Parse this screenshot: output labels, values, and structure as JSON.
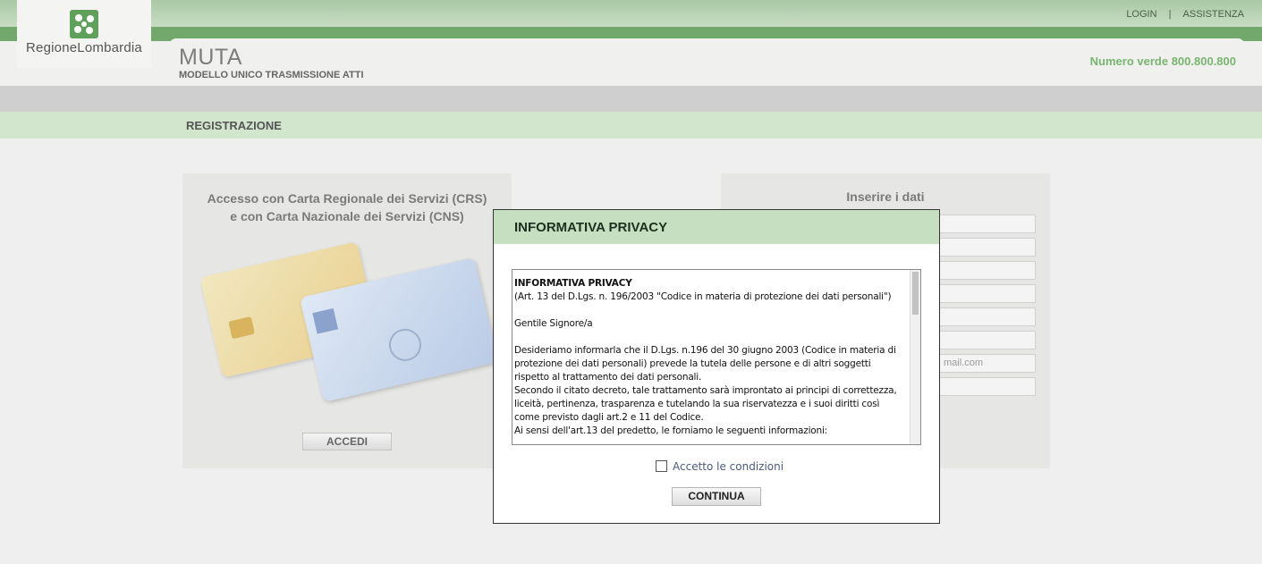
{
  "header": {
    "brand": "RegioneLombardia",
    "links": [
      "LOGIN",
      "ASSISTENZA"
    ],
    "separator": "|",
    "app_title": "MUTA",
    "app_subtitle": "MODELLO UNICO TRASMISSIONE ATTI",
    "phone": "Numero verde 800.800.800"
  },
  "section": {
    "title": "REGISTRAZIONE"
  },
  "left_panel": {
    "title_line1": "Accesso con Carta Regionale dei Servizi (CRS)",
    "title_line2": "e con Carta Nazionale dei Servizi (CNS)",
    "button": "ACCEDI"
  },
  "right_panel": {
    "title": "Inserire i dati",
    "email_placeholder_fragment": "mail.com"
  },
  "dialog": {
    "title": "INFORMATIVA PRIVACY",
    "body": {
      "heading": "INFORMATIVA PRIVACY",
      "ref": "(Art. 13 del D.Lgs. n. 196/2003 \"Codice in materia di protezione dei dati personali\")",
      "greeting": "Gentile Signore/a",
      "p1": "Desideriamo informarla che il D.Lgs. n.196 del 30 giugno 2003 (Codice in materia di protezione dei dati personali) prevede la tutela delle persone e di altri soggetti rispetto al trattamento dei dati personali.",
      "p2": "Secondo il citato decreto, tale trattamento sarà improntato ai principi di correttezza, liceità, pertinenza, trasparenza e tutelando la sua riservatezza e i suoi diritti così come previsto dagli art.2 e 11 del Codice.",
      "p3": "Ai sensi dell'art.13 del predetto, le forniamo le seguenti informazioni:"
    },
    "accept_label": "Accetto le condizioni",
    "continue_button": "CONTINUA"
  }
}
